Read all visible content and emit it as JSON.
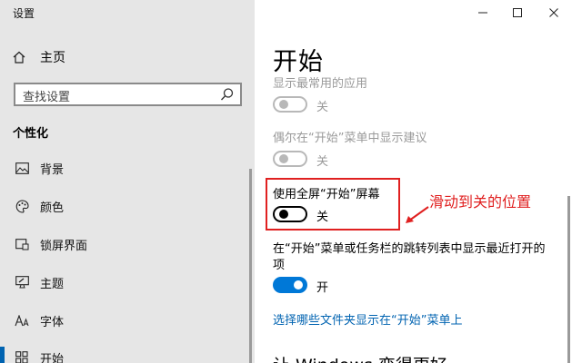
{
  "window": {
    "title": "设置",
    "controls": [
      "minimize-icon",
      "maximize-icon",
      "close-icon"
    ]
  },
  "sidebar": {
    "home_label": "主页",
    "search_placeholder": "查找设置",
    "section_title": "个性化",
    "items": [
      {
        "label": "背景",
        "icon": "picture-icon"
      },
      {
        "label": "颜色",
        "icon": "palette-icon"
      },
      {
        "label": "锁屏界面",
        "icon": "lock-screen-icon"
      },
      {
        "label": "主题",
        "icon": "theme-icon"
      },
      {
        "label": "字体",
        "icon": "font-icon"
      },
      {
        "label": "开始",
        "icon": "start-icon"
      }
    ],
    "selected_item": "开始"
  },
  "main": {
    "title": "开始",
    "settings": [
      {
        "label": "显示最常用的应用",
        "state": "关",
        "enabled": false,
        "on": false
      },
      {
        "label": "偶尔在“开始”菜单中显示建议",
        "state": "关",
        "enabled": false,
        "on": false
      },
      {
        "label": "使用全屏“开始”屏幕",
        "state": "关",
        "enabled": true,
        "on": false
      },
      {
        "label_line1": "在“开始”菜单或任务栏的跳转列表中显示最近打开的",
        "label_line2": "项",
        "state": "开",
        "enabled": true,
        "on": true
      }
    ],
    "link": "选择哪些文件夹显示在“开始”菜单上",
    "next_heading": "让 Windows 变得更好"
  },
  "annotation": {
    "text": "滑动到关的位置",
    "color": "#e02020"
  },
  "colors": {
    "accent": "#0078d7",
    "sidebar_bg": "#e6e6e6",
    "link": "#0063b1"
  }
}
